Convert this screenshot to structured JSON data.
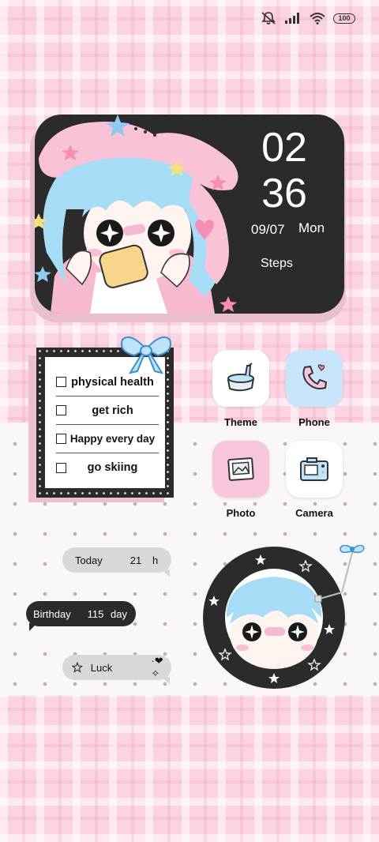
{
  "status_bar": {
    "icons": [
      "mute-icon",
      "signal-icon",
      "wifi-icon"
    ],
    "battery": "100"
  },
  "clock_widget": {
    "hour": "02",
    "minute": "36",
    "date": "09/07",
    "weekday": "Mon",
    "steps_label": "Steps"
  },
  "todo": {
    "items": [
      {
        "label": "physical health",
        "checked": false
      },
      {
        "label": "get rich",
        "checked": false
      },
      {
        "label": "Happy every day",
        "checked": false
      },
      {
        "label": "go skiing",
        "checked": false
      }
    ]
  },
  "apps": [
    {
      "label": "Theme",
      "icon": "paint-jar-icon",
      "tile_color": "#ffffff"
    },
    {
      "label": "Phone",
      "icon": "phone-icon",
      "tile_color": "#c9e5fb"
    },
    {
      "label": "Photo",
      "icon": "photo-frame-icon",
      "tile_color": "#f7c6dd"
    },
    {
      "label": "Camera",
      "icon": "camera-icon",
      "tile_color": "#ffffff"
    }
  ],
  "bubbles": {
    "today": {
      "label": "Today",
      "value": "21",
      "unit": "h"
    },
    "birthday": {
      "label": "Birthday",
      "value": "115",
      "unit": "day"
    },
    "luck": {
      "prefix_icon": "star-outline-icon",
      "label": "Luck",
      "suffix": "·❤✧"
    }
  },
  "colors": {
    "background_pink": "#fbd3e1",
    "widget_dark": "#2b2b2b",
    "accent_blue": "#8ec9f1",
    "accent_pink": "#f7a8c6"
  }
}
